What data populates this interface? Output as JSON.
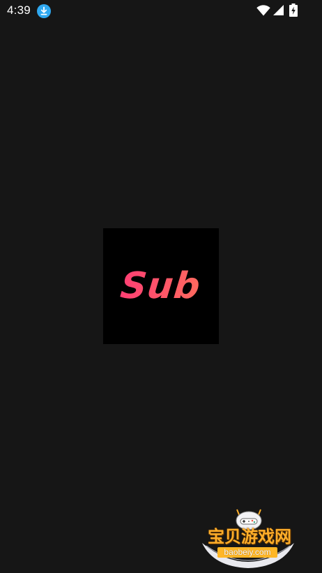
{
  "status_bar": {
    "time": "4:39",
    "icons": [
      "download-icon",
      "wifi-icon",
      "signal-icon",
      "battery-charging-icon"
    ]
  },
  "splash": {
    "logo_text": "Sub",
    "logo_gradient": [
      "#ff3f74",
      "#ff6a5e"
    ],
    "logo_background": "#000000"
  },
  "screen_background": "#161616",
  "watermark": {
    "title": "宝贝游戏网",
    "domain": "baobeiy.com"
  }
}
